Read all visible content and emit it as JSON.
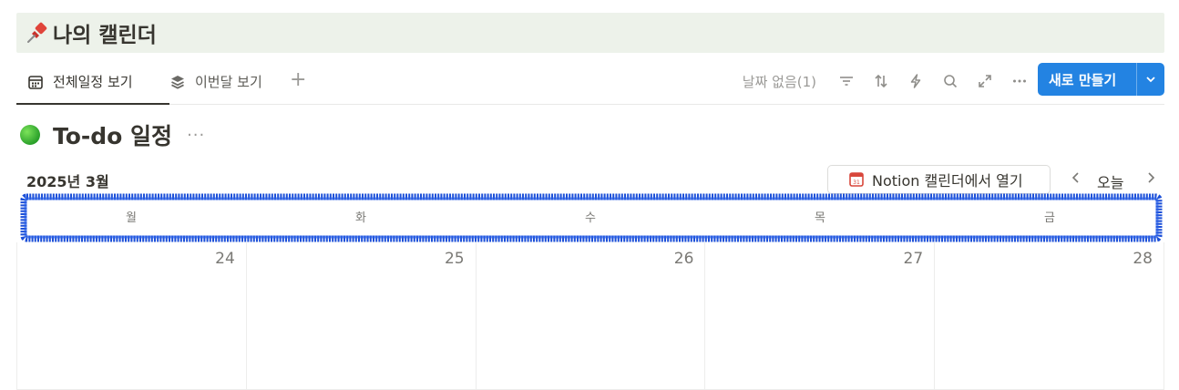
{
  "page": {
    "title": "나의 캘린더",
    "title_icon": "pushpin-icon"
  },
  "tabs": [
    {
      "label": "전체일정 보기",
      "icon": "calendar-icon",
      "active": true
    },
    {
      "label": "이번달 보기",
      "icon": "layers-icon",
      "active": false
    }
  ],
  "toolbar": {
    "no_date": "날짜 없음(1)",
    "icons": [
      "filter-icon",
      "sort-icon",
      "automation-icon",
      "search-icon",
      "expand-icon",
      "more-icon"
    ],
    "new_button": "새로 만들기"
  },
  "view": {
    "title": "To-do 일정",
    "more": "···"
  },
  "calendar": {
    "month_label": "2025년 3월",
    "open_in_notion": "Notion 캘린더에서 열기",
    "today_label": "오늘",
    "weekdays": [
      "월",
      "화",
      "수",
      "목",
      "금"
    ],
    "days": [
      "24",
      "25",
      "26",
      "27",
      "28"
    ]
  },
  "colors": {
    "banner_bg": "#edf2ea",
    "accent": "#2383e2",
    "highlight_scribble": "#1b4fd8"
  }
}
